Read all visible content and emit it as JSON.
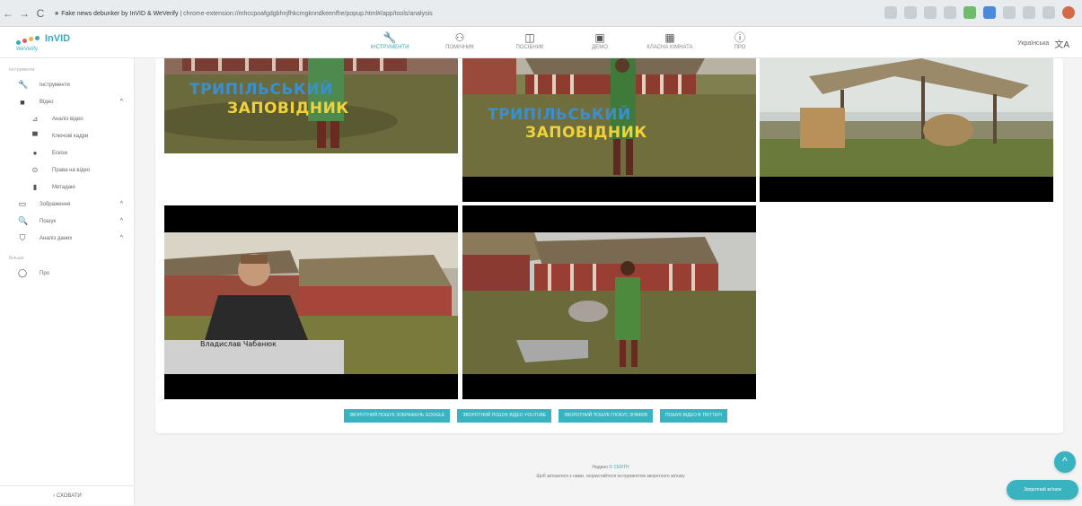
{
  "browser": {
    "nav": [
      "←",
      "→",
      "C"
    ],
    "tab_title": "Fake news debunker by InVID & WeVerify",
    "url": "chrome-extension://mhccpoafgdgbhnjfhkcmgknndkeenfhe/popup.html#/app/tools/analysis"
  },
  "app": {
    "logo_text": "InVID",
    "logo_sub": "WeVerify",
    "language": "Українська",
    "translate_glyph": "文A"
  },
  "tools": [
    {
      "icon": "🔧",
      "label": "ІНСТРУМЕНТИ"
    },
    {
      "icon": "⚇",
      "label": "ПОМІЧНИК"
    },
    {
      "icon": "◫",
      "label": "ПОСІБНИК"
    },
    {
      "icon": "▣",
      "label": "ДЕМО"
    },
    {
      "icon": "▦",
      "label": "КЛАСНА КІМНАТА"
    },
    {
      "icon": "ⓘ",
      "label": "ПРО"
    }
  ],
  "sidebar": {
    "section_tools": "Інструменти",
    "section_more": "Більше",
    "items": [
      {
        "icon": "🔧",
        "label": "Інструменти"
      },
      {
        "icon": "■",
        "label": "Відео",
        "chev": "^"
      },
      {
        "icon": "⊿",
        "label": "Аналіз відео",
        "sub": true
      },
      {
        "icon": "▀",
        "label": "Ключові кадри",
        "sub": true
      },
      {
        "icon": "●",
        "label": "Ескізи",
        "sub": true
      },
      {
        "icon": "⊙",
        "label": "Права на відео",
        "sub": true
      },
      {
        "icon": "▮",
        "label": "Метадані",
        "sub": true
      },
      {
        "icon": "▭",
        "label": "Зображення",
        "chev": "^"
      },
      {
        "icon": "🔍",
        "label": "Пошук",
        "chev": "^"
      },
      {
        "icon": "⛉",
        "label": "Аналіз даних",
        "chev": "^"
      }
    ],
    "more_items": [
      {
        "icon": "◯",
        "label": "Про"
      }
    ],
    "collapse_label": "‹  СХОВАТИ"
  },
  "frames": {
    "overlay_line1": "ТРИПІЛЬСЬКИЙ",
    "overlay_line2": "ЗАПОВІДНИК",
    "caption_name": "Владислав Чабанюк"
  },
  "actions": [
    "ЗВОРОТНИЙ ПОШУК ЗОБРАЖЕНЬ GOOGLE",
    "ЗВОРОТНИЙ ПОШУК ВІДЕО YOUTUBE",
    "ЗВОРОТНИЙ ПОШУК ГЛОБУС ЗНІМКІВ",
    "ПОШУК ВІДЕО В ТВІТТЕРІ"
  ],
  "footer": {
    "line1_prefix": "Надано ",
    "line1_link": "© CERTH",
    "line2": "Щоб зв'язатися з нами, скористайтеся інструментом зворотного зв'язку"
  },
  "fab_icon": "^",
  "feedback_label": "Зворотний зв'язок"
}
